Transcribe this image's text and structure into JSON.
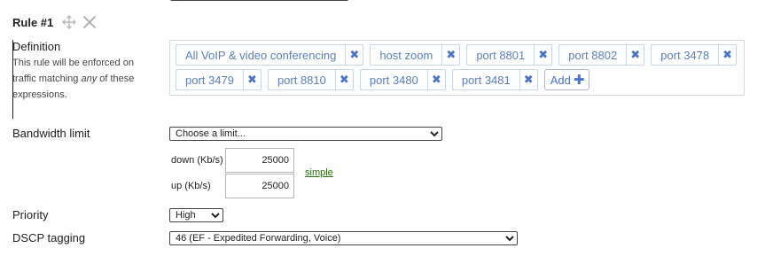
{
  "rule": {
    "title": "Rule #1"
  },
  "definition": {
    "label": "Definition",
    "help_prefix": "This rule will be enforced on traffic matching ",
    "help_emphasis": "any",
    "help_suffix": " of these expressions.",
    "tags": [
      "All VoIP & video conferencing",
      "host zoom",
      "port 8801",
      "port 8802",
      "port 3478",
      "port 3479",
      "port 8810",
      "port 3480",
      "port 3481"
    ],
    "add_label": "Add",
    "remove_glyph": "✖"
  },
  "bandwidth": {
    "label": "Bandwidth limit",
    "select_value": "Choose a limit...",
    "down_label": "down (Kb/s)",
    "down_value": "25000",
    "up_label": "up (Kb/s)",
    "up_value": "25000",
    "simple_link": "simple"
  },
  "priority": {
    "label": "Priority",
    "select_value": "High"
  },
  "dscp": {
    "label": "DSCP tagging",
    "select_value": "46 (EF - Expedited Forwarding, Voice)"
  },
  "colors": {
    "tag_text": "#5b7fbf",
    "tag_x": "#4a74c9",
    "link": "#2b6e0f"
  },
  "icons": {
    "move": "move-arrows-icon",
    "remove_rule": "close-icon",
    "tag_remove": "x-icon",
    "add": "plus-icon"
  }
}
